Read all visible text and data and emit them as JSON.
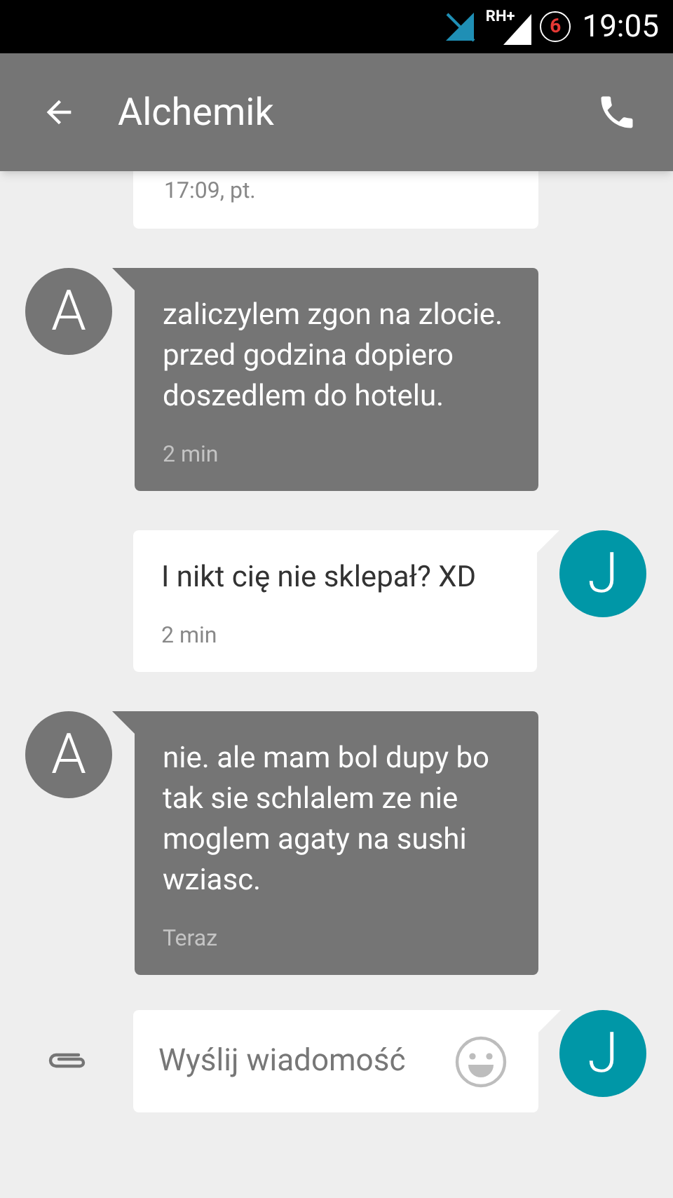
{
  "status_bar": {
    "network": "RH+",
    "notification_count": "6",
    "time": "19:05"
  },
  "app_bar": {
    "title": "Alchemik"
  },
  "partial_message": {
    "time": "17:09, pt."
  },
  "messages": [
    {
      "kind": "incoming",
      "avatar": "A",
      "text": "zaliczylem zgon na zlocie.\nprzed godzina dopiero doszedlem do hotelu.",
      "time": "2 min"
    },
    {
      "kind": "outgoing",
      "avatar": "J",
      "text": "I nikt cię nie sklepał? XD",
      "time": "2 min"
    },
    {
      "kind": "incoming",
      "avatar": "A",
      "text": "nie. ale mam bol dupy bo tak sie schlalem ze nie moglem agaty na sushi wziasc.",
      "time": "Teraz"
    }
  ],
  "composer": {
    "placeholder": "Wyślij wiadomość",
    "avatar": "J"
  }
}
